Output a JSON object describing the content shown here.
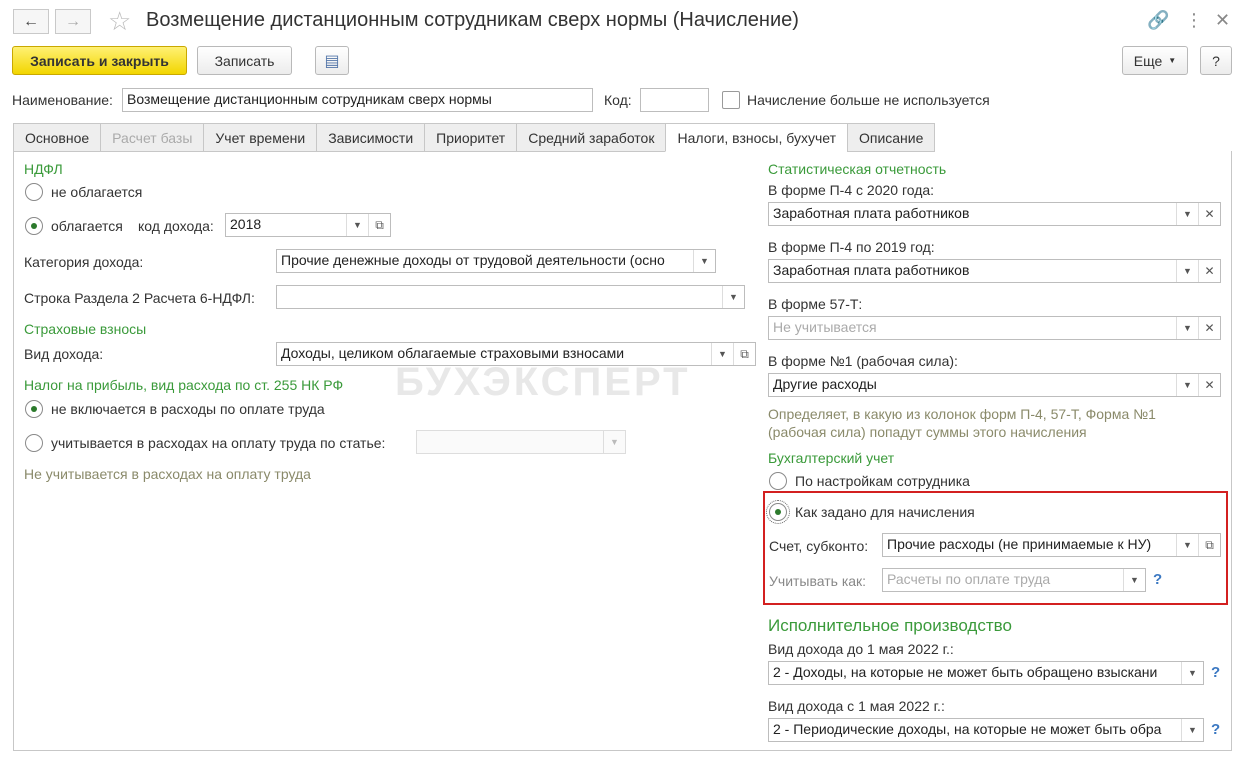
{
  "window": {
    "title": "Возмещение дистанционным сотрудникам сверх нормы (Начисление)"
  },
  "toolbar": {
    "save_close_label": "Записать и закрыть",
    "save_label": "Записать",
    "more_label": "Еще",
    "help_label": "?"
  },
  "header": {
    "name_label": "Наименование:",
    "name_value": "Возмещение дистанционным сотрудникам сверх нормы",
    "code_label": "Код:",
    "code_value": "",
    "unused_label": "Начисление больше не используется"
  },
  "tabs": [
    {
      "label": "Основное"
    },
    {
      "label": "Расчет базы"
    },
    {
      "label": "Учет времени"
    },
    {
      "label": "Зависимости"
    },
    {
      "label": "Приоритет"
    },
    {
      "label": "Средний заработок"
    },
    {
      "label": "Налоги, взносы, бухучет"
    },
    {
      "label": "Описание"
    }
  ],
  "watermark": "БУХЭКСПЕРТ",
  "left": {
    "ndfl_heading": "НДФЛ",
    "not_taxed_label": "не облагается",
    "taxed_label": "облагается",
    "income_code_label": "код дохода:",
    "income_code_value": "2018",
    "income_category_label": "Категория дохода:",
    "income_category_value": "Прочие денежные доходы от трудовой деятельности (осно",
    "line_label": "Строка Раздела 2 Расчета 6-НДФЛ:",
    "line_value": "",
    "insurance_heading": "Страховые взносы",
    "income_type_label": "Вид дохода:",
    "income_type_value": "Доходы, целиком облагаемые страховыми взносами",
    "profit_heading": "Налог на прибыль, вид расхода по ст. 255 НК РФ",
    "not_included_label": "не включается в расходы по оплате труда",
    "included_label": "учитывается в расходах на оплату труда по статье:",
    "article_value": "",
    "profit_note": "Не учитывается в расходах на оплату труда"
  },
  "right": {
    "stat_heading": "Статистическая отчетность",
    "p4_2020_label": "В форме П-4 с 2020 года:",
    "p4_2020_value": "Заработная плата работников",
    "p4_2019_label": "В форме П-4 по 2019 год:",
    "p4_2019_value": "Заработная плата работников",
    "f57t_label": "В форме 57-Т:",
    "f57t_value": "Не учитывается",
    "f1_label": "В форме №1 (рабочая сила):",
    "f1_value": "Другие расходы",
    "stat_note_1": "Определяет, в какую из колонок форм П-4, 57-Т, Форма №1",
    "stat_note_2": "(рабочая сила) попадут суммы этого начисления",
    "acc_heading": "Бухгалтерский учет",
    "by_employee_label": "По настройкам сотрудника",
    "as_set_label": "Как задано для начисления",
    "account_label": "Счет, субконто:",
    "account_value": "Прочие расходы (не принимаемые к НУ)",
    "account_as_label": "Учитывать как:",
    "account_as_value": "Расчеты по оплате труда",
    "enforcement_heading": "Исполнительное производство",
    "before_may_label": "Вид дохода до 1 мая 2022 г.:",
    "before_may_value": "2 - Доходы, на которые не может быть обращено взыскани",
    "after_may_label": "Вид дохода с 1 мая 2022 г.:",
    "after_may_value": "2 - Периодические доходы, на которые не может быть обра"
  }
}
